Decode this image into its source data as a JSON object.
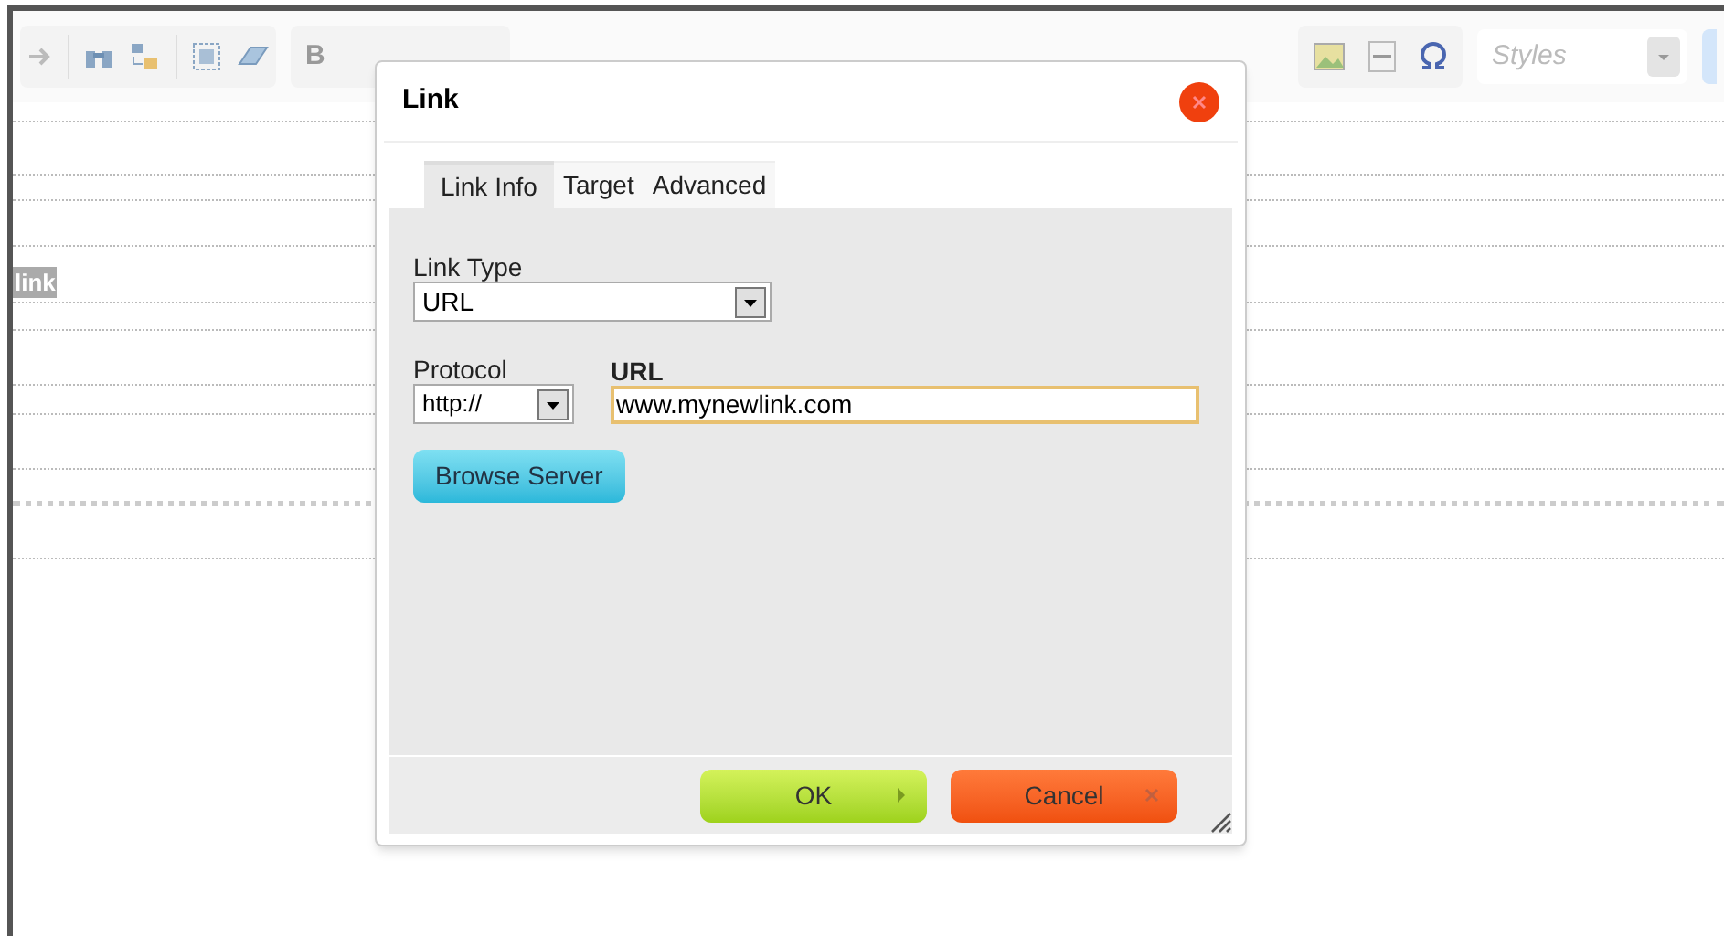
{
  "toolbar": {
    "bold_label": "B",
    "styles_placeholder": "Styles"
  },
  "editor": {
    "selected_text": "link",
    "selected": true
  },
  "dialog": {
    "title": "Link",
    "tabs": [
      {
        "label": "Link Info",
        "selected": true
      },
      {
        "label": "Target",
        "selected": false
      },
      {
        "label": "Advanced",
        "selected": false
      }
    ],
    "link_type": {
      "label": "Link Type",
      "value": "URL"
    },
    "protocol": {
      "label": "Protocol",
      "value": "http://"
    },
    "url": {
      "label": "URL",
      "value": "www.mynewlink.com",
      "focused": true
    },
    "browse_button": "Browse Server",
    "buttons": [
      {
        "kind": "ok",
        "label": "OK"
      },
      {
        "kind": "cancel",
        "label": "Cancel"
      }
    ]
  }
}
